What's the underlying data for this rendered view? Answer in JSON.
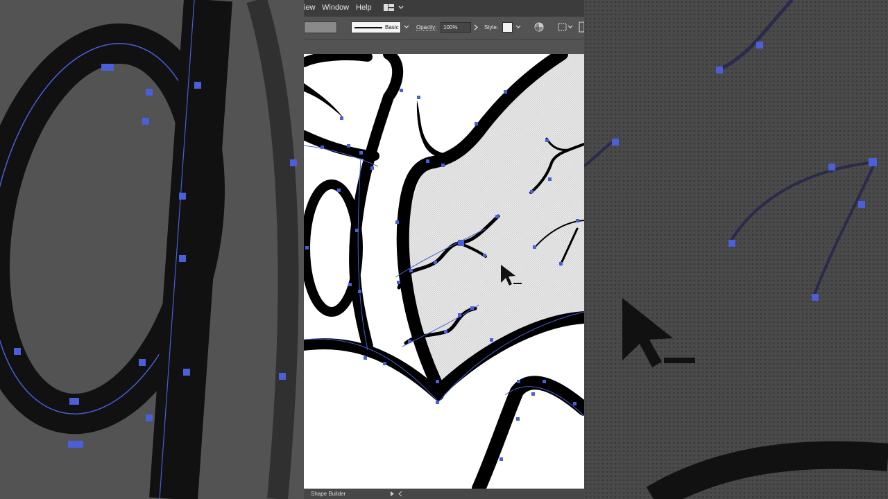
{
  "menubar": {
    "items": [
      "iew",
      "Window",
      "Help"
    ]
  },
  "control_bar": {
    "stroke_style_label": "Basic",
    "opacity_label": "Opacity:",
    "opacity_value": "100%",
    "style_label": "Style:"
  },
  "status_bar": {
    "tool_name": "Shape Builder"
  },
  "colors": {
    "selection_blue": "#4a5fd8",
    "artboard": "#ffffff",
    "ui_dark": "#3c3c3c",
    "ui_mid": "#535353"
  },
  "icons": [
    "workspace-switcher-icon",
    "recolor-artwork-icon",
    "align-grid-icon",
    "selection-cursor-icon",
    "play-icon"
  ]
}
